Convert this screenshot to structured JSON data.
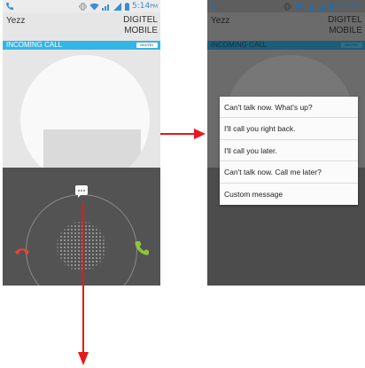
{
  "status_bar": {
    "time": "5:14",
    "ampm": "PM"
  },
  "call_left": {
    "caller_name": "Yezz",
    "carrier_line1": "DIGITEL",
    "carrier_line2": "MOBILE",
    "incoming_label": "INCOMING CALL",
    "network_badge": "DIGITEL"
  },
  "call_right": {
    "caller_name": "Yezz",
    "carrier_line1": "DIGITEL",
    "carrier_line2": "MOBILE",
    "incoming_label": "INCOMING CALL",
    "network_badge": "DIGITEL"
  },
  "quick_replies": [
    "Can't talk now. What's up?",
    "I'll call you right back.",
    "I'll call you later.",
    "Can't talk now. Call me later?",
    "Custom message"
  ],
  "icons": {
    "message": "message-icon",
    "decline": "decline-call-icon",
    "answer": "answer-call-icon",
    "arrow": "red-arrow"
  },
  "colors": {
    "accent_blue": "#33b5e5",
    "arrow_red": "#e8171b",
    "answer_green": "#8cc63f",
    "decline_red": "#e8403b"
  }
}
